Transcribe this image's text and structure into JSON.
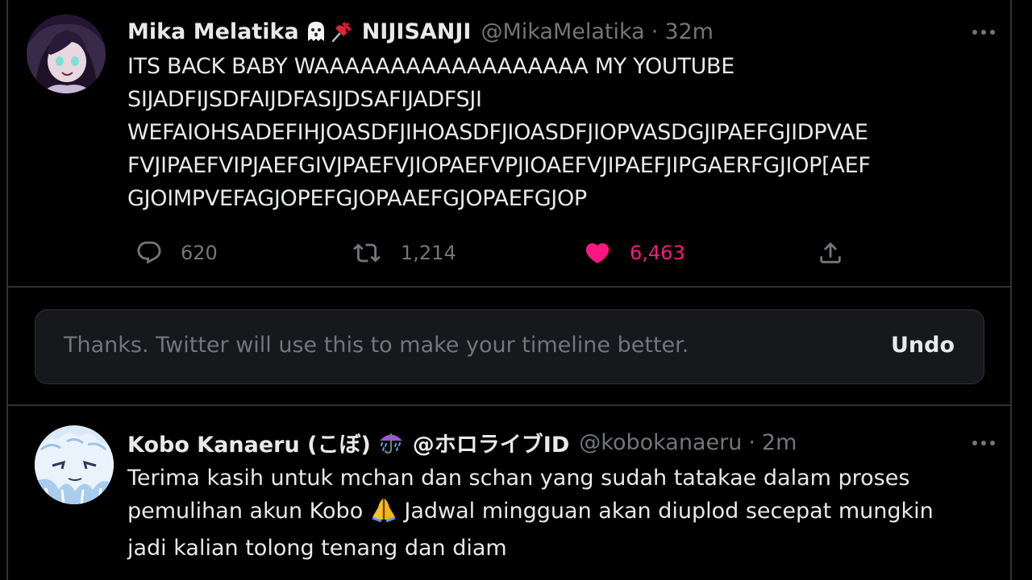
{
  "tweets": [
    {
      "author": {
        "name": "Mika Melatika",
        "affiliation": "NIJISANJI",
        "handle": "@MikaMelatika",
        "emojis": [
          "ghost-icon",
          "pushpin-icon"
        ]
      },
      "time": "32m",
      "text": "ITS BACK BABY WAAAAAAAAAAAAAAAAAA MY YOUTUBE\nSIJADFIJSDFAIJDFASIJDSAFIJADFSJI\nWEFAIOHSADEFIHJOASDFJIHOASDFJIOASDFJIOPVASDGJIPAEFGJIDPVAE\nFVJIPAEFVIPJAEFGIVJPAEFVJIOPAEFVPJIOAEFVJIPAEFJIPGAERFGJIOP[AEF\nGJOIMPVEFAGJOPEFGJOPAAEFGJOPAEFGJOP",
      "stats": {
        "replies": "620",
        "retweets": "1,214",
        "likes": "6,463"
      }
    },
    {
      "author": {
        "name": "Kobo Kanaeru (こぼ)",
        "affiliation": "@ホロライブID",
        "handle": "@kobokanaeru",
        "emojis": [
          "umbrella-rain-icon"
        ]
      },
      "time": "2m",
      "text_before_emoji": "Terima kasih untuk mchan dan schan yang sudah tatakae dalam proses\npemulihan akun Kobo ",
      "text_after_emoji": " Jadwal mingguan akan diuplod secepat mungkin\njadi kalian tolong tenang dan diam",
      "inline_emoji": "folded-hands-icon"
    }
  ],
  "notice": {
    "message": "Thanks. Twitter will use this to make your timeline better.",
    "undo_label": "Undo"
  },
  "separator": "·",
  "colors": {
    "background": "#000000",
    "like": "#f91880",
    "muted": "#71767b",
    "text": "#e7e9ea",
    "border": "#2f3336"
  }
}
